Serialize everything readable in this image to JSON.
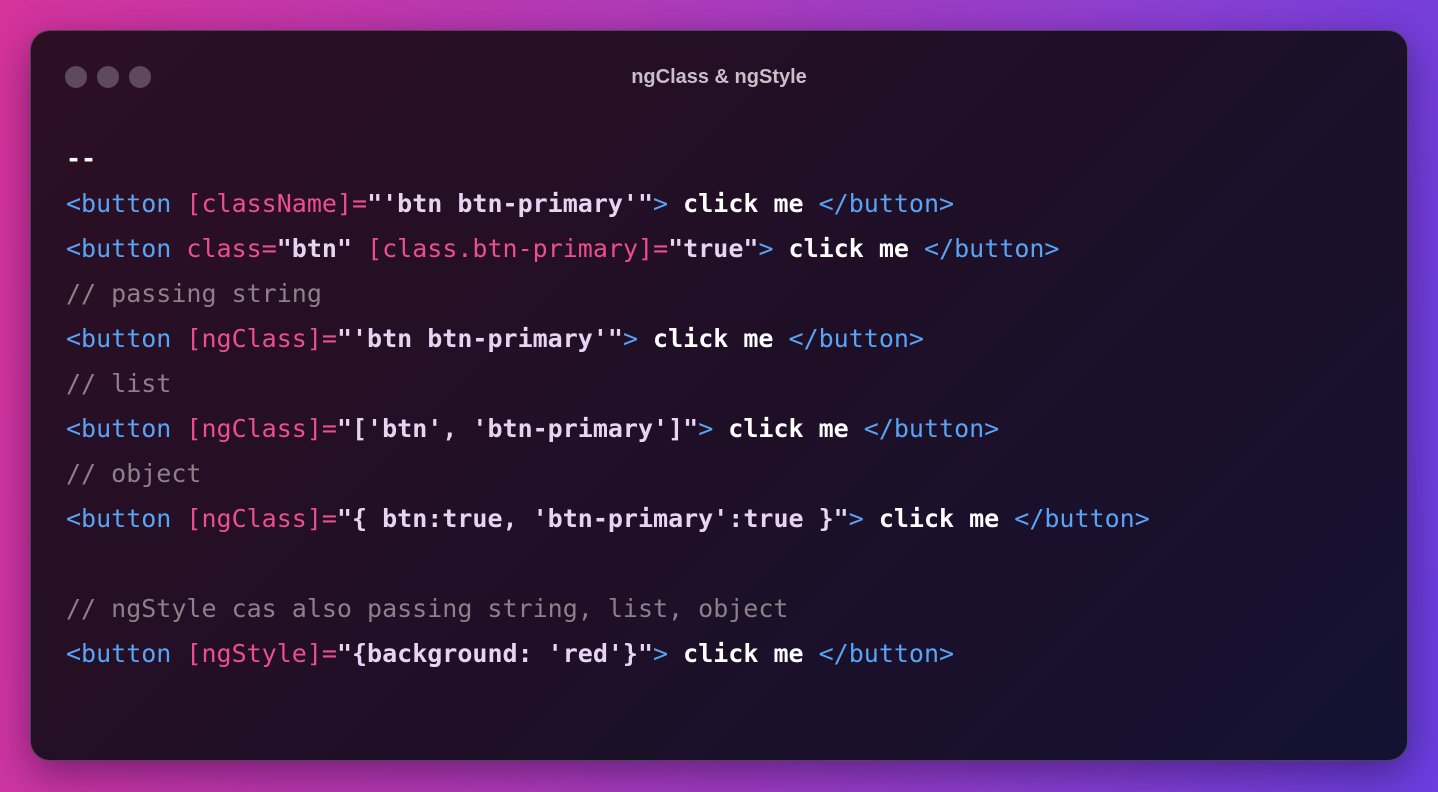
{
  "window": {
    "title": "ngClass & ngStyle"
  },
  "code_lines": [
    [
      {
        "t": "--",
        "c": "plain"
      }
    ],
    [
      {
        "t": "<button ",
        "c": "tag"
      },
      {
        "t": "[className]",
        "c": "attr"
      },
      {
        "t": "=",
        "c": "punc"
      },
      {
        "t": "\"'btn btn-primary'\"",
        "c": "str"
      },
      {
        "t": ">",
        "c": "tag"
      },
      {
        "t": " click me ",
        "c": "text"
      },
      {
        "t": "</button>",
        "c": "tag"
      }
    ],
    [
      {
        "t": "<button ",
        "c": "tag"
      },
      {
        "t": "class",
        "c": "attr"
      },
      {
        "t": "=",
        "c": "punc"
      },
      {
        "t": "\"btn\"",
        "c": "str"
      },
      {
        "t": " ",
        "c": "tag"
      },
      {
        "t": "[class.btn-primary]",
        "c": "attr"
      },
      {
        "t": "=",
        "c": "punc"
      },
      {
        "t": "\"true\"",
        "c": "str"
      },
      {
        "t": ">",
        "c": "tag"
      },
      {
        "t": " click me ",
        "c": "text"
      },
      {
        "t": "</button>",
        "c": "tag"
      }
    ],
    [
      {
        "t": "// passing string",
        "c": "cmt"
      }
    ],
    [
      {
        "t": "<button ",
        "c": "tag"
      },
      {
        "t": "[ngClass]",
        "c": "attr"
      },
      {
        "t": "=",
        "c": "punc"
      },
      {
        "t": "\"'btn btn-primary'\"",
        "c": "str"
      },
      {
        "t": ">",
        "c": "tag"
      },
      {
        "t": " click me ",
        "c": "text"
      },
      {
        "t": "</button>",
        "c": "tag"
      }
    ],
    [
      {
        "t": "// list",
        "c": "cmt"
      }
    ],
    [
      {
        "t": "<button ",
        "c": "tag"
      },
      {
        "t": "[ngClass]",
        "c": "attr"
      },
      {
        "t": "=",
        "c": "punc"
      },
      {
        "t": "\"['btn', 'btn-primary']\"",
        "c": "str"
      },
      {
        "t": ">",
        "c": "tag"
      },
      {
        "t": " click me ",
        "c": "text"
      },
      {
        "t": "</button>",
        "c": "tag"
      }
    ],
    [
      {
        "t": "// object",
        "c": "cmt"
      }
    ],
    [
      {
        "t": "<button ",
        "c": "tag"
      },
      {
        "t": "[ngClass]",
        "c": "attr"
      },
      {
        "t": "=",
        "c": "punc"
      },
      {
        "t": "\"{ btn:true, 'btn-primary':true }\"",
        "c": "str"
      },
      {
        "t": ">",
        "c": "tag"
      },
      {
        "t": " click me ",
        "c": "text"
      },
      {
        "t": "</button>",
        "c": "tag"
      }
    ],
    [],
    [
      {
        "t": "// ngStyle cas also passing string, list, object",
        "c": "cmt"
      }
    ],
    [
      {
        "t": "<button ",
        "c": "tag"
      },
      {
        "t": "[ngStyle]",
        "c": "attr"
      },
      {
        "t": "=",
        "c": "punc"
      },
      {
        "t": "\"{background: 'red'}\"",
        "c": "str"
      },
      {
        "t": ">",
        "c": "tag"
      },
      {
        "t": " click me ",
        "c": "text"
      },
      {
        "t": "</button>",
        "c": "tag"
      }
    ]
  ],
  "colors": {
    "tag": "#58a4f5",
    "attribute": "#ec4f8c",
    "string": "#e5d4f2",
    "text": "#ffffff",
    "comment": "#8d8089",
    "window_dot": "#5e4a5c"
  }
}
